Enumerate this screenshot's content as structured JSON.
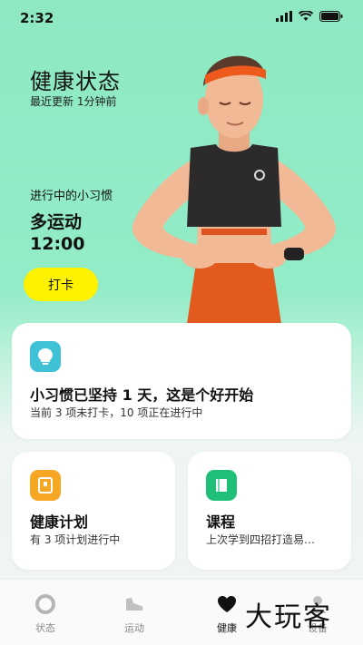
{
  "status_bar": {
    "time": "2:32",
    "icons": [
      "signal-icon",
      "wifi-icon",
      "battery-icon"
    ]
  },
  "header": {
    "title": "健康状态",
    "subtitle": "最近更新 1分钟前"
  },
  "habit": {
    "label": "进行中的小习惯",
    "name": "多运动",
    "time": "12:00",
    "checkin_label": "打卡"
  },
  "summary_card": {
    "title": "小习惯已坚持 1 天，这是个好开始",
    "desc": "当前 3 项未打卡，10 项正在进行中",
    "icon": "bulb-icon"
  },
  "plan_card": {
    "title": "健康计划",
    "desc": "有 3 项计划进行中",
    "icon": "bookmark-icon"
  },
  "course_card": {
    "title": "课程",
    "desc": "上次学到四招打造易…",
    "icon": "book-icon"
  },
  "bottom_nav": {
    "items": [
      {
        "label": "状态",
        "icon": "status-ring-icon"
      },
      {
        "label": "运动",
        "icon": "shoe-icon"
      },
      {
        "label": "健康",
        "icon": "heart-icon"
      },
      {
        "label": "设备",
        "icon": "profile-icon"
      }
    ]
  },
  "watermark": "大玩客",
  "colors": {
    "accent_yellow": "#fff200",
    "mint_background": "#8ee9c3",
    "bulb_teal": "#3fc1d6",
    "plan_orange": "#f5a623",
    "course_green": "#1fbf7a"
  }
}
